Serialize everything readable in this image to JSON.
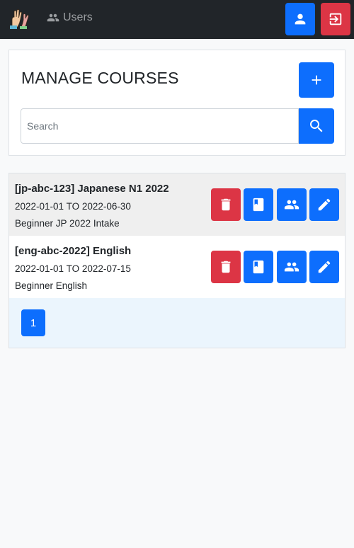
{
  "navbar": {
    "users_label": "Users",
    "icons": {
      "users": "users-icon",
      "user": "user-icon",
      "logout": "logout-icon"
    },
    "colors": {
      "background": "#212529",
      "primary": "#0d6efd",
      "danger": "#dc3545"
    }
  },
  "header": {
    "title": "MANAGE COURSES",
    "add_icon": "plus-icon"
  },
  "search": {
    "placeholder": "Search",
    "value": "",
    "icon": "search-icon"
  },
  "courses": [
    {
      "title": "[jp-abc-123] Japanese N1 2022",
      "dates": "2022-01-01 TO 2022-06-30",
      "description": "Beginner JP 2022 Intake"
    },
    {
      "title": "[eng-abc-2022] English",
      "dates": "2022-01-01 TO 2022-07-15",
      "description": "Beginner English"
    }
  ],
  "course_actions": [
    "trash-icon",
    "book-icon",
    "group-icon",
    "pencil-icon"
  ],
  "pagination": {
    "pages": [
      "1"
    ],
    "current": "1"
  }
}
